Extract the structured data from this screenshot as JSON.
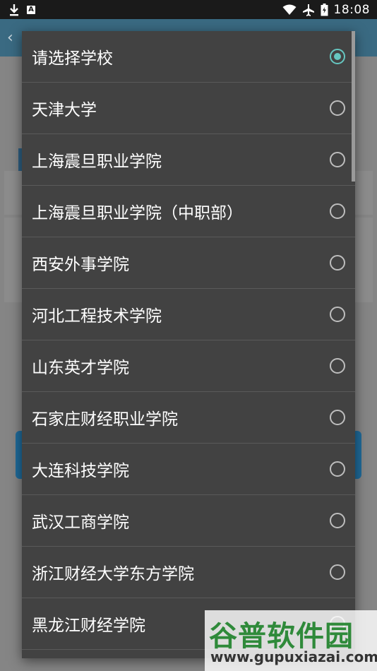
{
  "status_bar": {
    "time": "18:08",
    "left_icons": [
      "download-icon",
      "app-notification-icon"
    ],
    "app_badge_letter": "A",
    "right_icons": [
      "wifi-icon",
      "airplane-mode-icon",
      "battery-icon"
    ]
  },
  "dialog": {
    "options": [
      {
        "label": "请选择学校",
        "selected": true
      },
      {
        "label": "天津大学",
        "selected": false
      },
      {
        "label": "上海震旦职业学院",
        "selected": false
      },
      {
        "label": "上海震旦职业学院（中职部）",
        "selected": false
      },
      {
        "label": "西安外事学院",
        "selected": false
      },
      {
        "label": "河北工程技术学院",
        "selected": false
      },
      {
        "label": "山东英才学院",
        "selected": false
      },
      {
        "label": "石家庄财经职业学院",
        "selected": false
      },
      {
        "label": "大连科技学院",
        "selected": false
      },
      {
        "label": "武汉工商学院",
        "selected": false
      },
      {
        "label": "浙江财经大学东方学院",
        "selected": false
      },
      {
        "label": "黑龙江财经学院",
        "selected": false
      },
      {
        "label": "",
        "selected": false
      }
    ]
  },
  "watermark": {
    "main": "谷普软件园",
    "url": "www.gupuxiazai.com"
  },
  "colors": {
    "accent": "#66c6c0",
    "dialog_bg": "#424242",
    "status_bar_bg": "#1a1a1a"
  }
}
